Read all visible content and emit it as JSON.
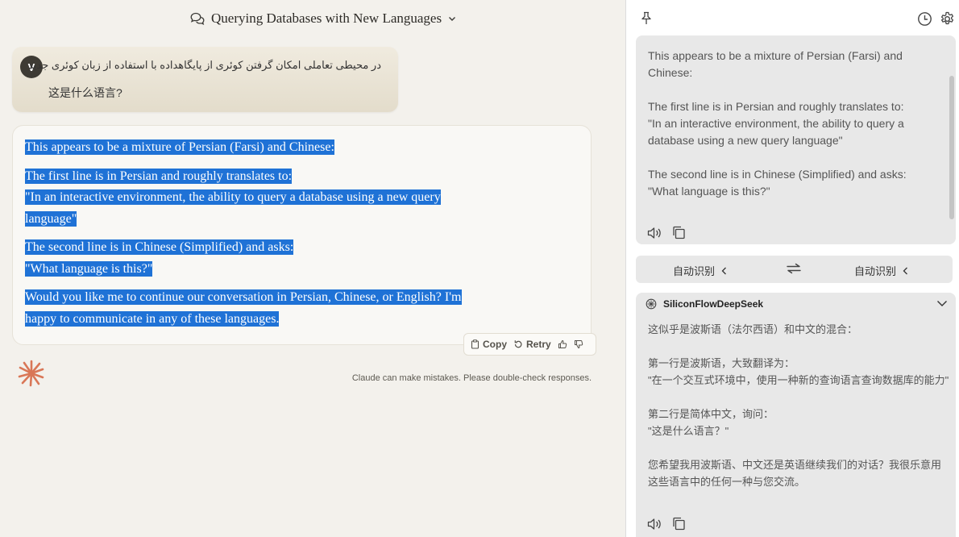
{
  "chat": {
    "title": "Querying Databases with New Languages",
    "user_avatar": "V",
    "user_message_line1": "در محیطی تعاملی امکان گرفتن کوئری از پایگاهداده با استفاده از زبان کوئری جدید",
    "user_message_line2": "这是什么语言?",
    "response": {
      "p1": "This appears to be a mixture of Persian (Farsi) and Chinese:",
      "p2a": "The first line is in Persian and roughly translates to:",
      "p2b": "\"In an interactive environment, the ability to query a database using a new query",
      "p2c": "language\"",
      "p3a": "The second line is in Chinese (Simplified) and asks:",
      "p3b": "\"What language is this?\"",
      "p4a": "Would you like me to continue our conversation in Persian, Chinese, or English? I'm",
      "p4b": "happy to communicate in any of these languages."
    },
    "actions": {
      "copy": "Copy",
      "retry": "Retry"
    },
    "disclaimer": "Claude can make mistakes. Please double-check responses.",
    "highlight_color": "#1f72d6"
  },
  "panel": {
    "source_text": "This appears to be a mixture of Persian (Farsi) and Chinese:\n\nThe first line is in Persian and roughly translates to:\n\"In an interactive environment, the ability to query a database using a new query language\"\n\nThe second line is in Chinese (Simplified) and asks:\n\"What language is this?\"",
    "source_lang": "自动识别",
    "target_lang": "自动识别",
    "engine_name": "SiliconFlowDeepSeek",
    "translation": "这似乎是波斯语（法尔西语）和中文的混合：\n\n第一行是波斯语，大致翻译为：\n\"在一个交互式环境中，使用一种新的查询语言查询数据库的能力\"\n\n第二行是简体中文，询问：\n\"这是什么语言？\"\n\n您希望我用波斯语、中文还是英语继续我们的对话？我很乐意用这些语言中的任何一种与您交流。"
  }
}
